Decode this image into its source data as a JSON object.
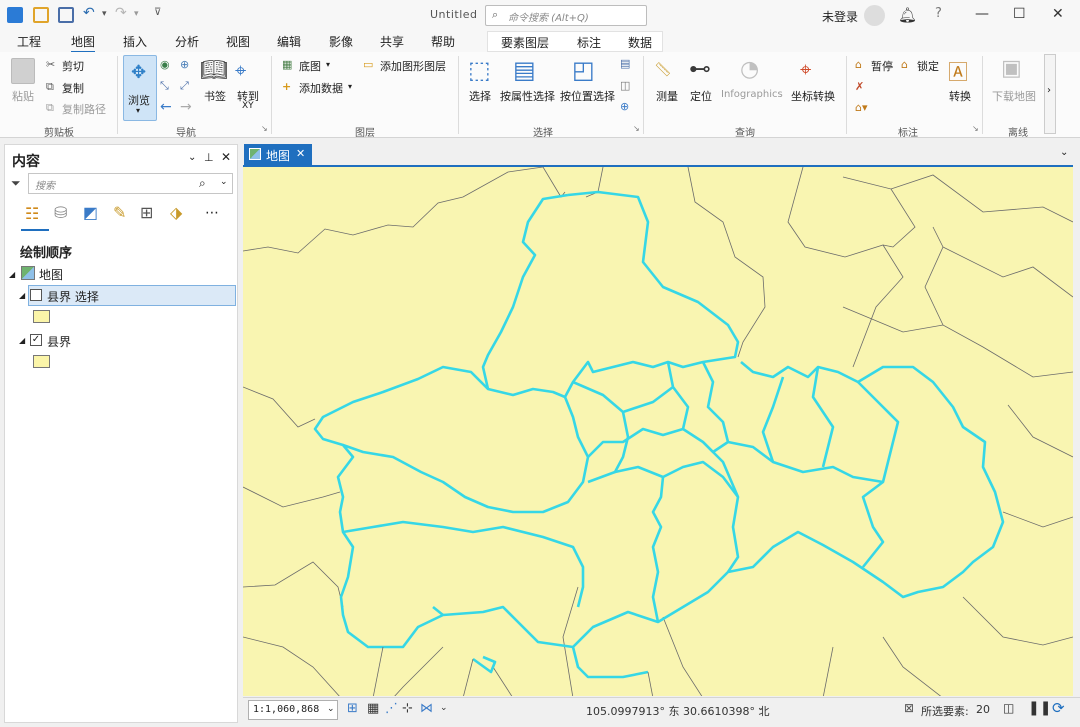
{
  "window": {
    "title": "Untitled",
    "search_placeholder": "命令搜索 (Alt+Q)",
    "login": "未登录"
  },
  "tabs": [
    "工程",
    "地图",
    "插入",
    "分析",
    "视图",
    "编辑",
    "影像",
    "共享",
    "帮助"
  ],
  "active_tab": "地图",
  "context_tabs": [
    "要素图层",
    "标注",
    "数据"
  ],
  "ribbon": {
    "clipboard": {
      "paste": "粘贴",
      "cut": "剪切",
      "copy": "复制",
      "copy_path": "复制路径",
      "label": "剪贴板"
    },
    "navigate": {
      "explore": "浏览",
      "bookmarks": "书签",
      "goto_xy": "转到",
      "goto_xy_sub": "XY",
      "label": "导航"
    },
    "layer": {
      "basemap": "底图",
      "add_data": "添加数据",
      "add_graphics": "添加图形图层",
      "label": "图层"
    },
    "selection": {
      "select": "选择",
      "by_attr": "按属性选择",
      "by_loc": "按位置选择",
      "label": "选择"
    },
    "inquiry": {
      "measure": "测量",
      "locate": "定位",
      "infographics": "Infographics",
      "convert_coords": "坐标转换",
      "label": "查询"
    },
    "labeling": {
      "pause": "暂停",
      "lock": "锁定",
      "convert": "转换",
      "label": "标注"
    },
    "offline": {
      "download": "下载地图",
      "label": "离线"
    }
  },
  "contents": {
    "title": "内容",
    "search_placeholder": "搜索",
    "draw_order": "绘制顺序",
    "map_name": "地图",
    "layers": [
      {
        "name": "县界 选择",
        "checked": false,
        "selected": true
      },
      {
        "name": "县界",
        "checked": true,
        "selected": false
      }
    ]
  },
  "map_tab": {
    "label": "地图"
  },
  "status": {
    "scale": "1:1,060,868",
    "coords": "105.0997913° 东  30.6610398° 北",
    "selected_features_label": "所选要素:",
    "selected_features_count": "20"
  },
  "colors": {
    "map_fill": "#f9f5b1",
    "selection": "#36d7e6",
    "accent": "#1f6fbf",
    "boundary": "#6b6b6b"
  }
}
